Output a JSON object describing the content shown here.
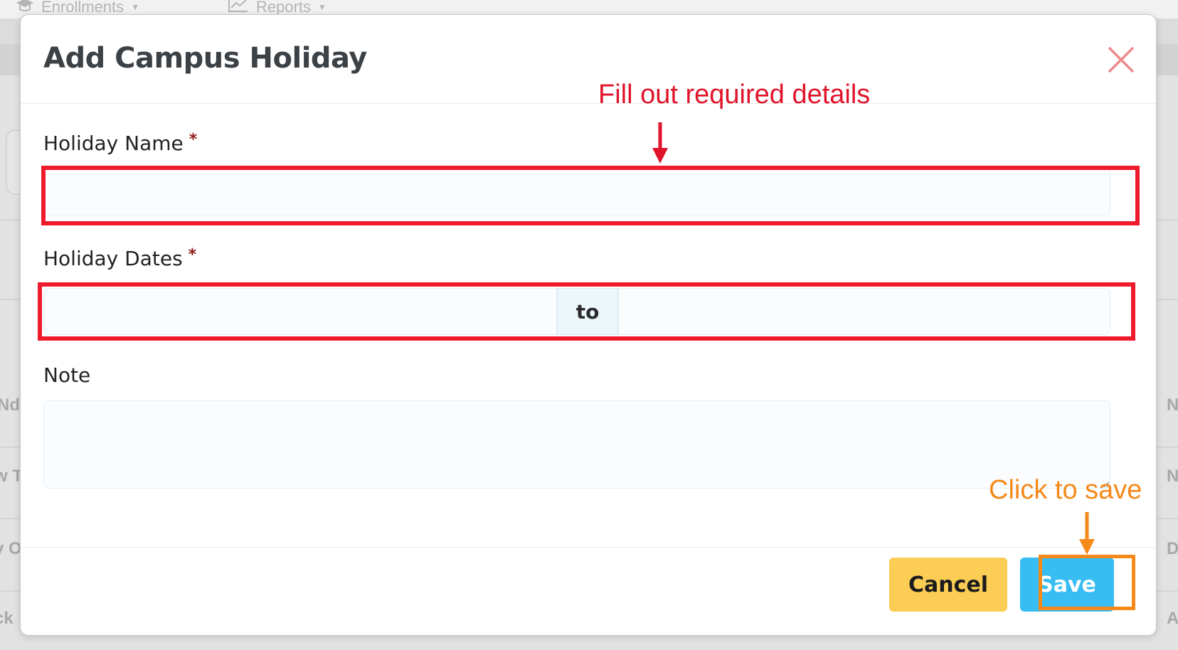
{
  "background": {
    "nav": [
      {
        "label": "Enrollments",
        "icon": "graduation-cap-icon"
      },
      {
        "label": "Reports",
        "icon": "chart-line-icon"
      }
    ],
    "side_text": [
      "Nd",
      "N",
      "w T",
      "N",
      "y O",
      "D",
      "ck",
      "A"
    ]
  },
  "modal": {
    "title": "Add Campus Holiday",
    "close_icon": "close-icon",
    "fields": {
      "holiday_name": {
        "label": "Holiday Name",
        "required_mark": "*",
        "value": "",
        "placeholder": ""
      },
      "holiday_dates": {
        "label": "Holiday Dates",
        "required_mark": "*",
        "start_value": "",
        "separator": "to",
        "end_value": ""
      },
      "note": {
        "label": "Note",
        "value": "",
        "placeholder": ""
      }
    },
    "buttons": {
      "cancel": "Cancel",
      "save": "Save"
    }
  },
  "annotations": {
    "fill_details": "Fill out required details",
    "click_save": "Click to save",
    "colors": {
      "red": "#ef1b2d",
      "orange": "#f5891a"
    }
  },
  "colors": {
    "cancel_button": "#fbcd54",
    "save_button": "#38bdf2",
    "close_icon": "#ee8a8a",
    "required_mark": "#8b1a1a"
  }
}
